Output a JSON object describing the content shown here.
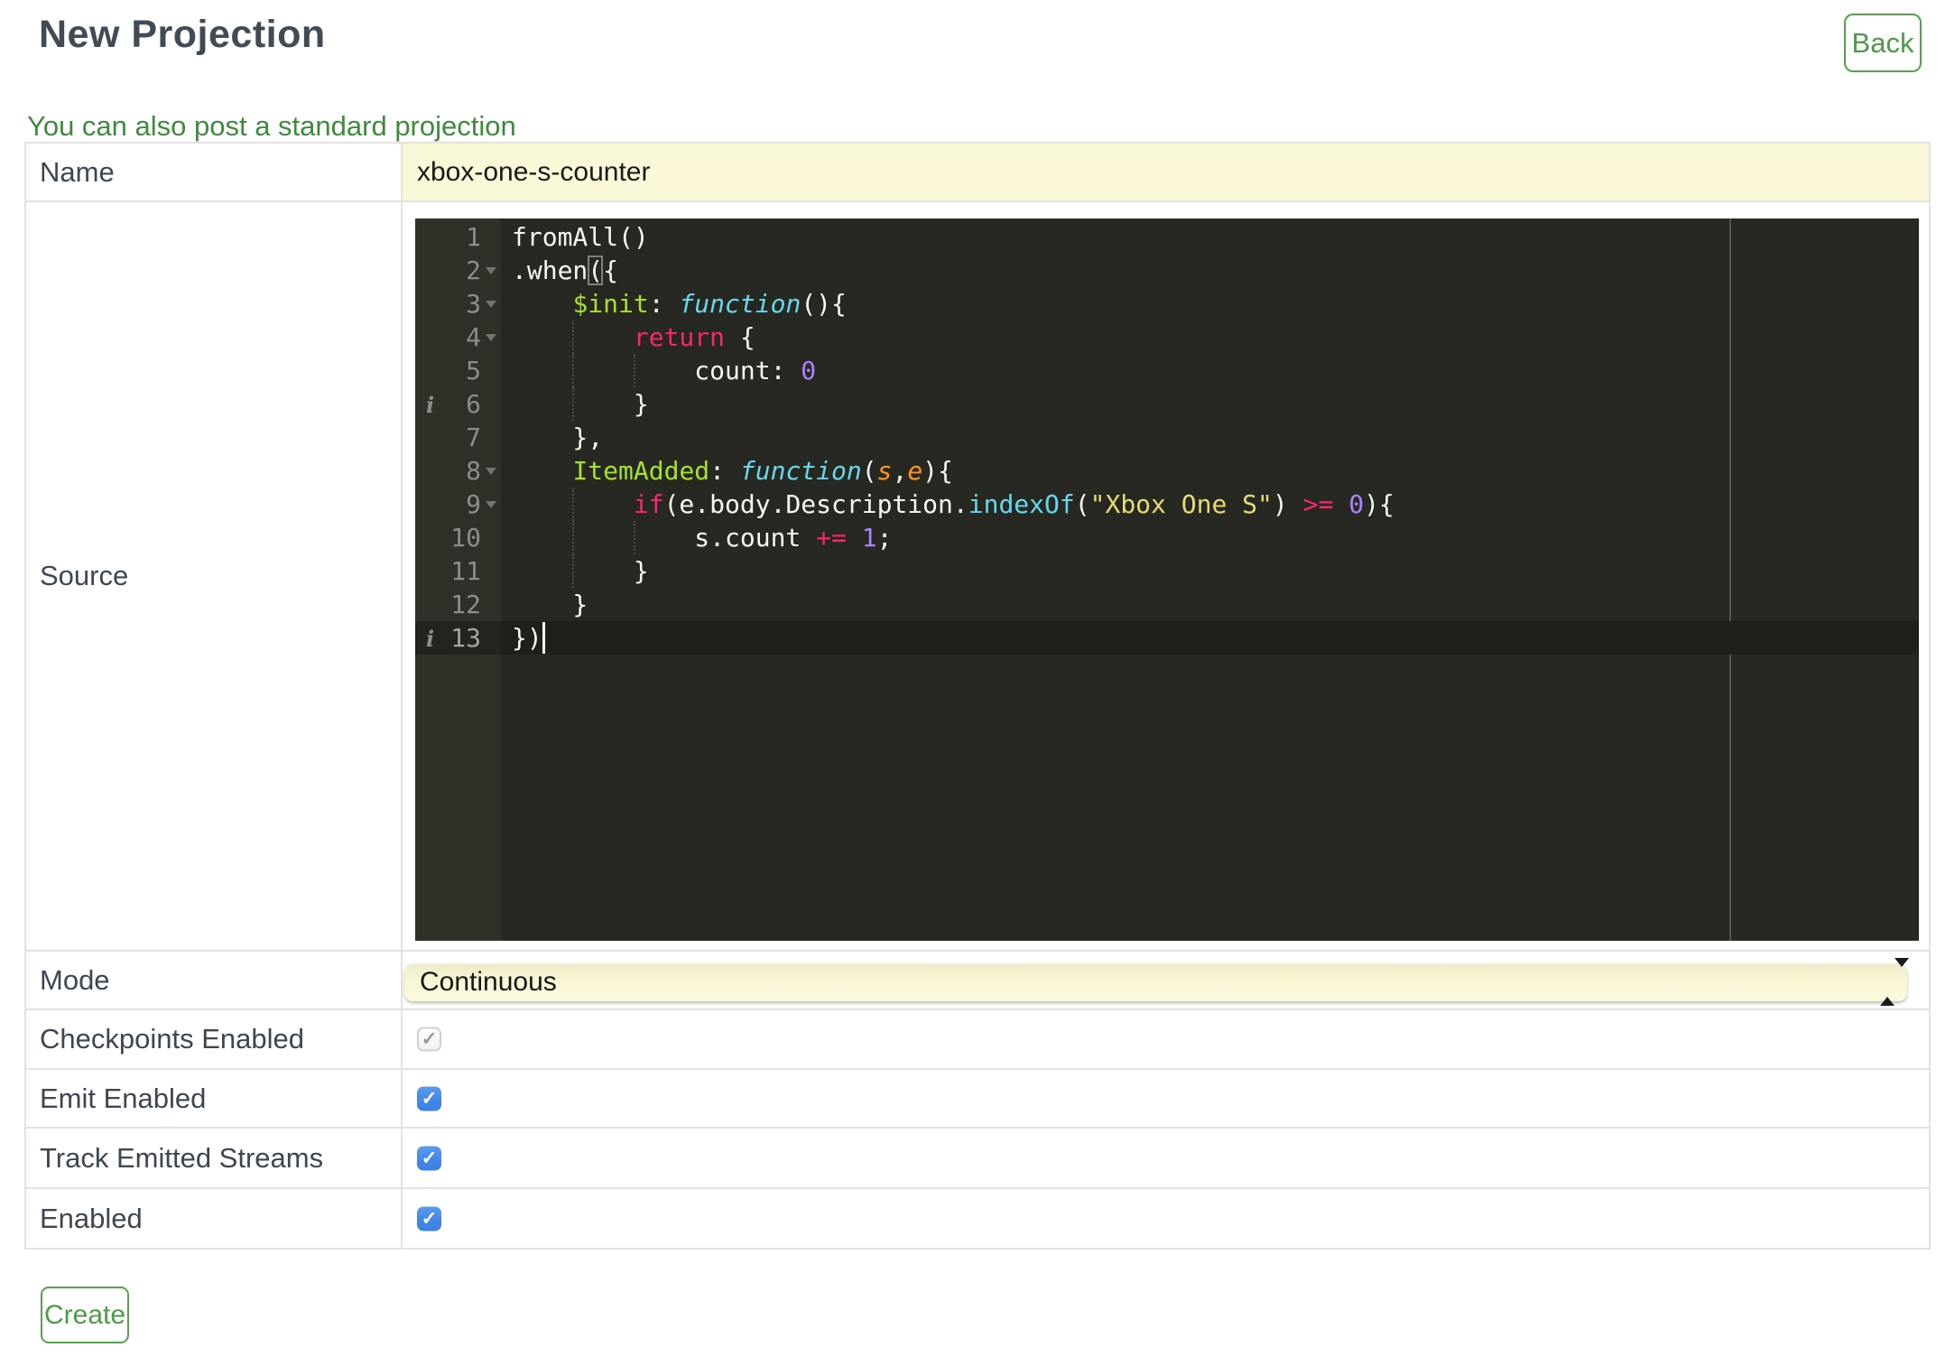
{
  "page": {
    "title": "New Projection"
  },
  "header": {
    "back_label": "Back"
  },
  "link": {
    "text": "You can also post a standard projection"
  },
  "form": {
    "name": {
      "label": "Name",
      "value": "xbox-one-s-counter"
    },
    "source": {
      "label": "Source"
    },
    "mode": {
      "label": "Mode",
      "value": "Continuous"
    },
    "checkboxes": [
      {
        "label": "Checkpoints Enabled",
        "checked": true,
        "disabled": true
      },
      {
        "label": "Emit Enabled",
        "checked": true,
        "disabled": false
      },
      {
        "label": "Track Emitted Streams",
        "checked": true,
        "disabled": false
      },
      {
        "label": "Enabled",
        "checked": true,
        "disabled": false
      }
    ],
    "create_label": "Create",
    "checkmark_glyph": "✓"
  },
  "editor": {
    "theme": "monokai",
    "colors": {
      "background": "#272822",
      "gutter": "#2f3129",
      "active_line": "#1f1f1b",
      "keyword": "#f92672",
      "function": "#66d9ef",
      "entity": "#a6e22e",
      "param": "#fd971f",
      "string": "#e6db74",
      "number": "#ae81ff",
      "text": "#f8f8f2"
    },
    "active_line_number": 13,
    "lines": [
      {
        "num": 1,
        "fold": false,
        "annot": false,
        "active": false,
        "guides": [],
        "tokens": [
          [
            "w",
            "fromAll()"
          ]
        ]
      },
      {
        "num": 2,
        "fold": true,
        "annot": false,
        "active": false,
        "guides": [],
        "tokens": [
          [
            "w",
            ".when"
          ],
          [
            "wb",
            "("
          ],
          [
            "w",
            "{"
          ]
        ]
      },
      {
        "num": 3,
        "fold": true,
        "annot": false,
        "active": false,
        "guides": [],
        "tokens": [
          [
            "w",
            "    "
          ],
          [
            "g",
            "$init"
          ],
          [
            "w",
            ": "
          ],
          [
            "fn",
            "function"
          ],
          [
            "w",
            "(){"
          ]
        ]
      },
      {
        "num": 4,
        "fold": true,
        "annot": false,
        "active": false,
        "guides": [
          4
        ],
        "tokens": [
          [
            "w",
            "        "
          ],
          [
            "k",
            "return"
          ],
          [
            "w",
            " {"
          ]
        ]
      },
      {
        "num": 5,
        "fold": false,
        "annot": false,
        "active": false,
        "guides": [
          4,
          8
        ],
        "tokens": [
          [
            "w",
            "            count: "
          ],
          [
            "n",
            "0"
          ]
        ]
      },
      {
        "num": 6,
        "fold": false,
        "annot": true,
        "active": false,
        "guides": [
          4
        ],
        "tokens": [
          [
            "w",
            "        }"
          ]
        ]
      },
      {
        "num": 7,
        "fold": false,
        "annot": false,
        "active": false,
        "guides": [],
        "tokens": [
          [
            "w",
            "    },"
          ]
        ]
      },
      {
        "num": 8,
        "fold": true,
        "annot": false,
        "active": false,
        "guides": [],
        "tokens": [
          [
            "w",
            "    "
          ],
          [
            "g",
            "ItemAdded"
          ],
          [
            "w",
            ": "
          ],
          [
            "fn",
            "function"
          ],
          [
            "w",
            "("
          ],
          [
            "o",
            "s"
          ],
          [
            "w",
            ","
          ],
          [
            "o",
            "e"
          ],
          [
            "w",
            "){"
          ]
        ]
      },
      {
        "num": 9,
        "fold": true,
        "annot": false,
        "active": false,
        "guides": [
          4
        ],
        "tokens": [
          [
            "w",
            "        "
          ],
          [
            "k",
            "if"
          ],
          [
            "w",
            "(e.body.Description."
          ],
          [
            "cy",
            "indexOf"
          ],
          [
            "w",
            "("
          ],
          [
            "s",
            "\"Xbox One S\""
          ],
          [
            "w",
            ") "
          ],
          [
            "k",
            ">="
          ],
          [
            "w",
            " "
          ],
          [
            "n",
            "0"
          ],
          [
            "w",
            "){"
          ]
        ]
      },
      {
        "num": 10,
        "fold": false,
        "annot": false,
        "active": false,
        "guides": [
          4,
          8
        ],
        "tokens": [
          [
            "w",
            "            s.count "
          ],
          [
            "k",
            "+="
          ],
          [
            "w",
            " "
          ],
          [
            "n",
            "1"
          ],
          [
            "w",
            ";"
          ]
        ]
      },
      {
        "num": 11,
        "fold": false,
        "annot": false,
        "active": false,
        "guides": [
          4
        ],
        "tokens": [
          [
            "w",
            "        }"
          ]
        ]
      },
      {
        "num": 12,
        "fold": false,
        "annot": false,
        "active": false,
        "guides": [],
        "tokens": [
          [
            "w",
            "    }"
          ]
        ]
      },
      {
        "num": 13,
        "fold": false,
        "annot": true,
        "active": true,
        "guides": [],
        "tokens": [
          [
            "w",
            "})"
          ]
        ],
        "cursor_after_ch": 2
      }
    ]
  }
}
